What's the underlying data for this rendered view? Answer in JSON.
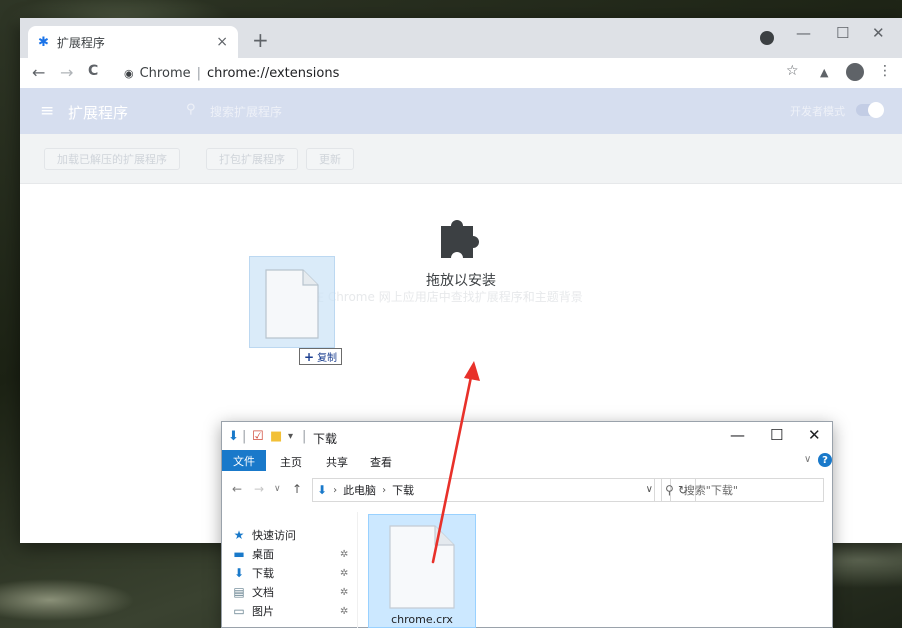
{
  "chrome": {
    "tab_title": "扩展程序",
    "tab_close": "×",
    "new_tab": "+",
    "window_controls": {
      "minimize": "—",
      "maximize": "☐",
      "close": "✕"
    },
    "omnibox": {
      "chip": "Chrome",
      "separator": "|",
      "url": "chrome://extensions"
    },
    "toolbar_icons": {
      "back": "←",
      "forward": "→",
      "reload": "C",
      "star": "☆",
      "lab": "▲",
      "menu": "⋮"
    }
  },
  "extensions_page": {
    "title": "扩展程序",
    "search_placeholder": "搜索扩展程序",
    "developer_mode_label": "开发者模式",
    "developer_mode_on": true,
    "buttons": [
      "加载已解压的扩展程序",
      "打包扩展程序",
      "更新"
    ],
    "webstore_text": "在 Chrome 网上应用店中查找扩展程序和主题背景",
    "drop_label": "拖放以安装"
  },
  "drag_ghost": {
    "copy_label": "复制",
    "plus": "+"
  },
  "explorer": {
    "title": "下载",
    "quick_access_sep": "|",
    "ribbon": {
      "file": "文件",
      "tabs": [
        "主页",
        "共享",
        "查看"
      ],
      "expand": "∨",
      "help": "?"
    },
    "nav_buttons": {
      "back": "←",
      "forward": "→",
      "recent": "∨",
      "up": "↑"
    },
    "address": {
      "crumbs": [
        "此电脑",
        "下载"
      ],
      "arrow": "›",
      "dropdown": "∨",
      "refresh": "↻"
    },
    "search_placeholder": "搜索\"下载\"",
    "nav_pane": [
      {
        "label": "快速访问",
        "icon": "star-icon",
        "pinned": false
      },
      {
        "label": "桌面",
        "icon": "desktop-icon",
        "pinned": true
      },
      {
        "label": "下载",
        "icon": "download-icon",
        "pinned": true
      },
      {
        "label": "文档",
        "icon": "document-icon",
        "pinned": true
      },
      {
        "label": "图片",
        "icon": "picture-icon",
        "pinned": true
      }
    ],
    "pin_glyph": "✲",
    "file": {
      "name": "chrome.crx"
    }
  },
  "colors": {
    "accent_blue": "#1979ca",
    "chrome_blue": "#1a73e8",
    "arrow_red": "#e8312a"
  }
}
